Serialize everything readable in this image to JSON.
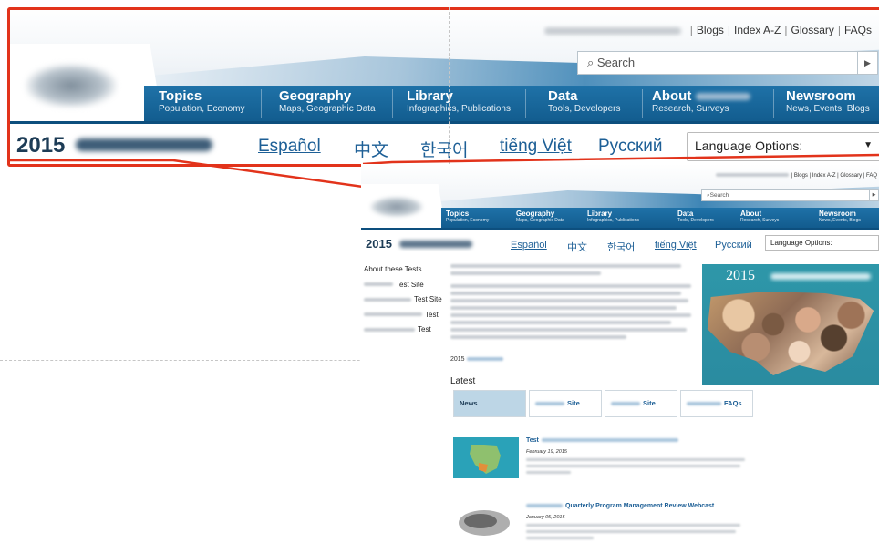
{
  "utility_links": [
    "Blogs",
    "Index A-Z",
    "Glossary",
    "FAQs"
  ],
  "mini_utility_links": [
    "Blogs",
    "Index A-Z",
    "Glossary",
    "FAQ"
  ],
  "search": {
    "placeholder": "Search",
    "icon": "search-icon"
  },
  "nav": [
    {
      "title": "Topics",
      "subtitle": "Population, Economy"
    },
    {
      "title": "Geography",
      "subtitle": "Maps, Geographic Data"
    },
    {
      "title": "Library",
      "subtitle": "Infographics, Publications"
    },
    {
      "title": "Data",
      "subtitle": "Tools, Developers"
    },
    {
      "title": "About",
      "subtitle": "Research, Surveys"
    },
    {
      "title": "Newsroom",
      "subtitle": "News, Events, Blogs"
    }
  ],
  "year": "2015",
  "languages": [
    "Español",
    "中文",
    "한국어",
    "tiếng Việt",
    "Русский"
  ],
  "language_select": "Language Options:",
  "sidebar": [
    "About these Tests",
    "Test Site",
    "Test Site",
    "Test",
    "Test"
  ],
  "hero_year": "2015",
  "subhead_year": "2015",
  "latest_label": "Latest",
  "tabs": [
    {
      "label": "News"
    },
    {
      "label": "Site"
    },
    {
      "label": "Site"
    },
    {
      "label": "FAQs"
    }
  ],
  "news": [
    {
      "title_lead": "Test",
      "date": "February 19, 2015"
    },
    {
      "title_tail": "Quarterly Program Management Review Webcast",
      "date": "January 05, 2015"
    }
  ],
  "colors": {
    "accent_red": "#e2331b",
    "nav_blue": "#125c8e",
    "link_blue": "#1d5f96"
  }
}
